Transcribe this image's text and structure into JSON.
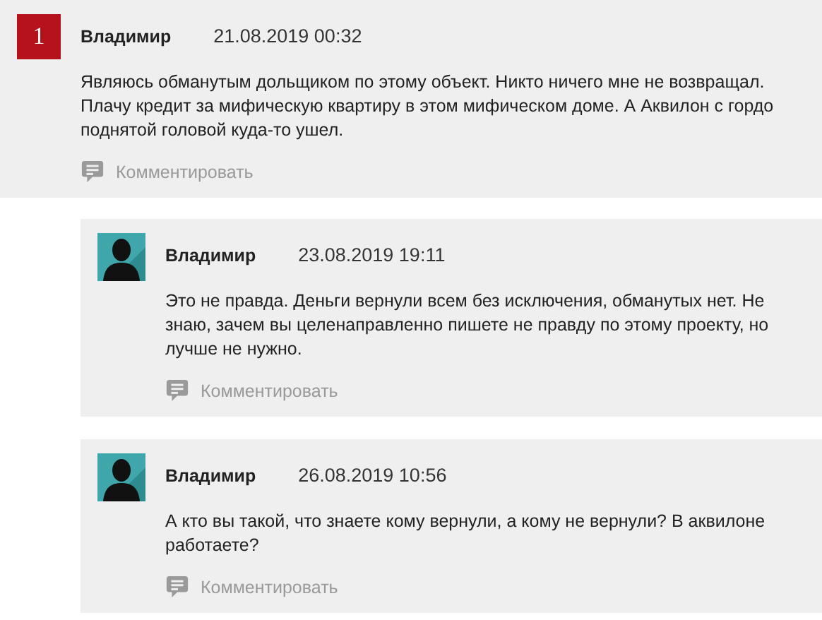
{
  "comments": [
    {
      "kind": "number",
      "badge": "1",
      "author": "Владимир",
      "date": "21.08.2019 00:32",
      "text": "Являюсь обманутым дольщиком по этому объект. Никто ничего мне не возвращал. Плачу кредит за мифическую квартиру в этом мифическом доме. А Аквилон с гордо поднятой головой куда-то ушел.",
      "action": "Комментировать",
      "children": [
        {
          "kind": "avatar",
          "author": "Владимир",
          "date": "23.08.2019 19:11",
          "text": "Это не правда. Деньги вернули всем без исключения, обманутых нет. Не знаю, зачем вы целенаправленно пишете не правду по этому проекту, но лучше не нужно.",
          "action": "Комментировать"
        },
        {
          "kind": "avatar",
          "author": "Владимир",
          "date": "26.08.2019 10:56",
          "text": "А кто вы такой, что знаете кому вернули, а кому не вернули? В аквилоне работаете?",
          "action": "Комментировать"
        }
      ]
    }
  ]
}
